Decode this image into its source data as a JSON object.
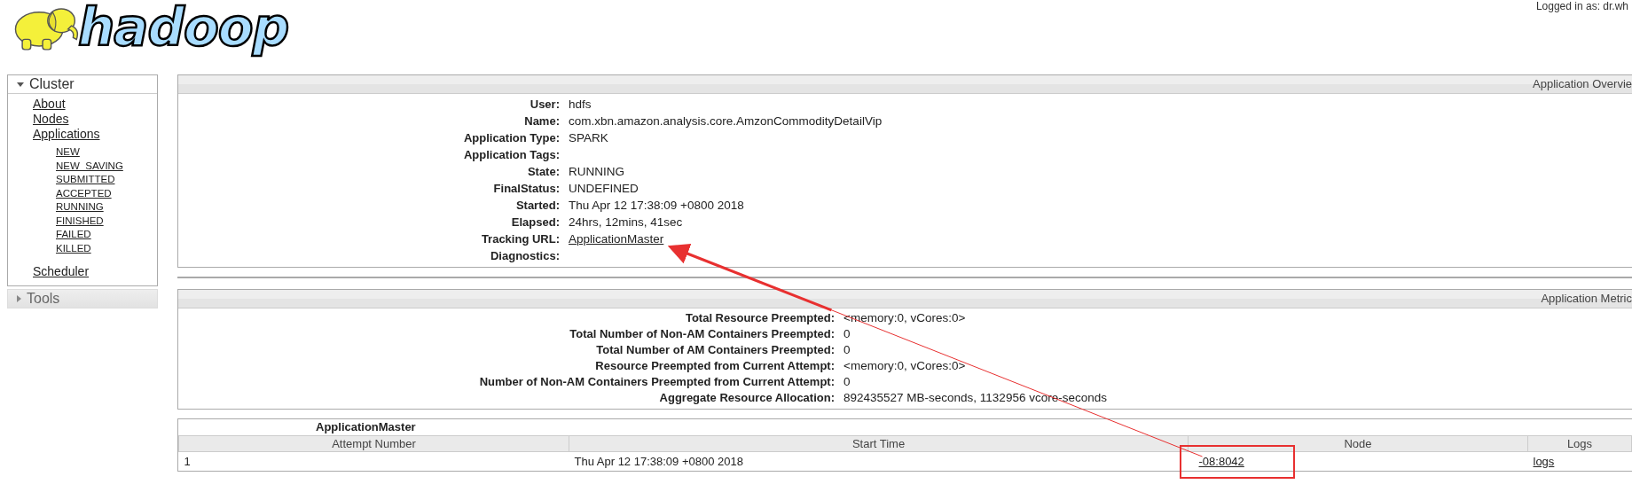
{
  "header": {
    "logo_text": "hadoop",
    "login": "Logged in as: dr.wh"
  },
  "sidebar": {
    "sections": [
      {
        "title": "Cluster",
        "expanded": true,
        "items": [
          {
            "label": "About"
          },
          {
            "label": "Nodes"
          },
          {
            "label": "Applications",
            "children": [
              {
                "label": "NEW"
              },
              {
                "label": "NEW_SAVING"
              },
              {
                "label": "SUBMITTED"
              },
              {
                "label": "ACCEPTED"
              },
              {
                "label": "RUNNING"
              },
              {
                "label": "FINISHED"
              },
              {
                "label": "FAILED"
              },
              {
                "label": "KILLED"
              }
            ]
          },
          {
            "label": "Scheduler"
          }
        ]
      },
      {
        "title": "Tools",
        "expanded": false
      }
    ]
  },
  "overview": {
    "title": "Application Overvie",
    "rows": [
      {
        "label": "User:",
        "value": "hdfs"
      },
      {
        "label": "Name:",
        "value": "com.xbn.amazon.analysis.core.AmzonCommodityDetailVip"
      },
      {
        "label": "Application Type:",
        "value": "SPARK"
      },
      {
        "label": "Application Tags:",
        "value": ""
      },
      {
        "label": "State:",
        "value": "RUNNING"
      },
      {
        "label": "FinalStatus:",
        "value": "UNDEFINED"
      },
      {
        "label": "Started:",
        "value": "Thu Apr 12 17:38:09 +0800 2018"
      },
      {
        "label": "Elapsed:",
        "value": "24hrs, 12mins, 41sec"
      },
      {
        "label": "Tracking URL:",
        "value": "ApplicationMaster",
        "kind": "link"
      },
      {
        "label": "Diagnostics:",
        "value": ""
      }
    ]
  },
  "metrics": {
    "title": "Application Metric",
    "rows": [
      {
        "label": "Total Resource Preempted:",
        "value": "<memory:0, vCores:0>"
      },
      {
        "label": "Total Number of Non-AM Containers Preempted:",
        "value": "0"
      },
      {
        "label": "Total Number of AM Containers Preempted:",
        "value": "0"
      },
      {
        "label": "Resource Preempted from Current Attempt:",
        "value": "<memory:0, vCores:0>"
      },
      {
        "label": "Number of Non-AM Containers Preempted from Current Attempt:",
        "value": "0"
      },
      {
        "label": "Aggregate Resource Allocation:",
        "value": "892435527 MB-seconds, 1132956 vcore-seconds"
      }
    ]
  },
  "attempts": {
    "title": "ApplicationMaster",
    "columns": [
      "Attempt Number",
      "Start Time",
      "Node",
      "Logs"
    ],
    "rows": [
      {
        "attempt": "1",
        "start": "Thu Apr 12 17:38:09 +0800 2018",
        "node": "-08:8042",
        "logs": "logs"
      }
    ]
  }
}
